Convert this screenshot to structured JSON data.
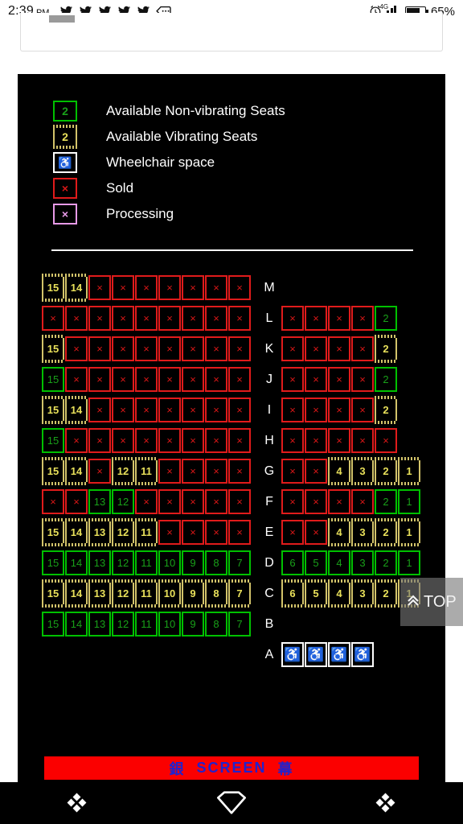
{
  "status_bar": {
    "time": "2:39",
    "ampm": "PM",
    "notification_icons": [
      "twitter-icon",
      "twitter-icon",
      "twitter-icon",
      "twitter-icon",
      "twitter-icon",
      "message-icon"
    ],
    "alarm_icon": "alarm-clock-icon",
    "network": "4G",
    "battery_percent": "65%"
  },
  "legend": {
    "items": [
      {
        "symbol": "2",
        "style": "green",
        "label": "Available Non-vibrating Seats"
      },
      {
        "symbol": "2",
        "style": "yellow",
        "label": "Available Vibrating Seats"
      },
      {
        "symbol": "♿",
        "style": "white",
        "label": "Wheelchair space"
      },
      {
        "symbol": "×",
        "style": "red",
        "label": "Sold"
      },
      {
        "symbol": "×",
        "style": "pink",
        "label": "Processing"
      }
    ]
  },
  "seatmap": {
    "sold_symbol": "×",
    "wheelchair_symbol": "♿",
    "rows": [
      {
        "label": "M",
        "left": [
          {
            "t": "yellow",
            "n": "15"
          },
          {
            "t": "yellow",
            "n": "14"
          },
          {
            "t": "red"
          },
          {
            "t": "red"
          },
          {
            "t": "red"
          },
          {
            "t": "red"
          },
          {
            "t": "red"
          },
          {
            "t": "red"
          },
          {
            "t": "red"
          }
        ],
        "right": []
      },
      {
        "label": "L",
        "left": [
          {
            "t": "red"
          },
          {
            "t": "red"
          },
          {
            "t": "red"
          },
          {
            "t": "red"
          },
          {
            "t": "red"
          },
          {
            "t": "red"
          },
          {
            "t": "red"
          },
          {
            "t": "red"
          },
          {
            "t": "red"
          }
        ],
        "right": [
          {
            "t": "red"
          },
          {
            "t": "red"
          },
          {
            "t": "red"
          },
          {
            "t": "red"
          },
          {
            "t": "green",
            "n": "2"
          }
        ]
      },
      {
        "label": "K",
        "left": [
          {
            "t": "yellow",
            "n": "15"
          },
          {
            "t": "red"
          },
          {
            "t": "red"
          },
          {
            "t": "red"
          },
          {
            "t": "red"
          },
          {
            "t": "red"
          },
          {
            "t": "red"
          },
          {
            "t": "red"
          },
          {
            "t": "red"
          }
        ],
        "right": [
          {
            "t": "red"
          },
          {
            "t": "red"
          },
          {
            "t": "red"
          },
          {
            "t": "red"
          },
          {
            "t": "yellow",
            "n": "2"
          }
        ]
      },
      {
        "label": "J",
        "left": [
          {
            "t": "green",
            "n": "15"
          },
          {
            "t": "red"
          },
          {
            "t": "red"
          },
          {
            "t": "red"
          },
          {
            "t": "red"
          },
          {
            "t": "red"
          },
          {
            "t": "red"
          },
          {
            "t": "red"
          },
          {
            "t": "red"
          }
        ],
        "right": [
          {
            "t": "red"
          },
          {
            "t": "red"
          },
          {
            "t": "red"
          },
          {
            "t": "red"
          },
          {
            "t": "green",
            "n": "2"
          }
        ]
      },
      {
        "label": "I",
        "left": [
          {
            "t": "yellow",
            "n": "15"
          },
          {
            "t": "yellow",
            "n": "14"
          },
          {
            "t": "red"
          },
          {
            "t": "red"
          },
          {
            "t": "red"
          },
          {
            "t": "red"
          },
          {
            "t": "red"
          },
          {
            "t": "red"
          },
          {
            "t": "red"
          }
        ],
        "right": [
          {
            "t": "red"
          },
          {
            "t": "red"
          },
          {
            "t": "red"
          },
          {
            "t": "red"
          },
          {
            "t": "yellow",
            "n": "2"
          }
        ]
      },
      {
        "label": "H",
        "left": [
          {
            "t": "green",
            "n": "15"
          },
          {
            "t": "red"
          },
          {
            "t": "red"
          },
          {
            "t": "red"
          },
          {
            "t": "red"
          },
          {
            "t": "red"
          },
          {
            "t": "red"
          },
          {
            "t": "red"
          },
          {
            "t": "red"
          }
        ],
        "right": [
          {
            "t": "red"
          },
          {
            "t": "red"
          },
          {
            "t": "red"
          },
          {
            "t": "red"
          },
          {
            "t": "red"
          }
        ]
      },
      {
        "label": "G",
        "left": [
          {
            "t": "yellow",
            "n": "15"
          },
          {
            "t": "yellow",
            "n": "14"
          },
          {
            "t": "red"
          },
          {
            "t": "yellow",
            "n": "12"
          },
          {
            "t": "yellow",
            "n": "11"
          },
          {
            "t": "red"
          },
          {
            "t": "red"
          },
          {
            "t": "red"
          },
          {
            "t": "red"
          }
        ],
        "right": [
          {
            "t": "red"
          },
          {
            "t": "red"
          },
          {
            "t": "yellow",
            "n": "4"
          },
          {
            "t": "yellow",
            "n": "3"
          },
          {
            "t": "yellow",
            "n": "2"
          },
          {
            "t": "yellow",
            "n": "1"
          }
        ]
      },
      {
        "label": "F",
        "left": [
          {
            "t": "red"
          },
          {
            "t": "red"
          },
          {
            "t": "green",
            "n": "13"
          },
          {
            "t": "green",
            "n": "12"
          },
          {
            "t": "red"
          },
          {
            "t": "red"
          },
          {
            "t": "red"
          },
          {
            "t": "red"
          },
          {
            "t": "red"
          }
        ],
        "right": [
          {
            "t": "red"
          },
          {
            "t": "red"
          },
          {
            "t": "red"
          },
          {
            "t": "red"
          },
          {
            "t": "green",
            "n": "2"
          },
          {
            "t": "green",
            "n": "1"
          }
        ]
      },
      {
        "label": "E",
        "left": [
          {
            "t": "yellow",
            "n": "15"
          },
          {
            "t": "yellow",
            "n": "14"
          },
          {
            "t": "yellow",
            "n": "13"
          },
          {
            "t": "yellow",
            "n": "12"
          },
          {
            "t": "yellow",
            "n": "11"
          },
          {
            "t": "red"
          },
          {
            "t": "red"
          },
          {
            "t": "red"
          },
          {
            "t": "red"
          }
        ],
        "right": [
          {
            "t": "red"
          },
          {
            "t": "red"
          },
          {
            "t": "yellow",
            "n": "4"
          },
          {
            "t": "yellow",
            "n": "3"
          },
          {
            "t": "yellow",
            "n": "2"
          },
          {
            "t": "yellow",
            "n": "1"
          }
        ]
      },
      {
        "label": "D",
        "left": [
          {
            "t": "green",
            "n": "15"
          },
          {
            "t": "green",
            "n": "14"
          },
          {
            "t": "green",
            "n": "13"
          },
          {
            "t": "green",
            "n": "12"
          },
          {
            "t": "green",
            "n": "11"
          },
          {
            "t": "green",
            "n": "10"
          },
          {
            "t": "green",
            "n": "9"
          },
          {
            "t": "green",
            "n": "8"
          },
          {
            "t": "green",
            "n": "7"
          }
        ],
        "right": [
          {
            "t": "green",
            "n": "6"
          },
          {
            "t": "green",
            "n": "5"
          },
          {
            "t": "green",
            "n": "4"
          },
          {
            "t": "green",
            "n": "3"
          },
          {
            "t": "green",
            "n": "2"
          },
          {
            "t": "green",
            "n": "1"
          }
        ]
      },
      {
        "label": "C",
        "left": [
          {
            "t": "yellow",
            "n": "15"
          },
          {
            "t": "yellow",
            "n": "14"
          },
          {
            "t": "yellow",
            "n": "13"
          },
          {
            "t": "yellow",
            "n": "12"
          },
          {
            "t": "yellow",
            "n": "11"
          },
          {
            "t": "yellow",
            "n": "10"
          },
          {
            "t": "yellow",
            "n": "9"
          },
          {
            "t": "yellow",
            "n": "8"
          },
          {
            "t": "yellow",
            "n": "7"
          }
        ],
        "right": [
          {
            "t": "yellow",
            "n": "6"
          },
          {
            "t": "yellow",
            "n": "5"
          },
          {
            "t": "yellow",
            "n": "4"
          },
          {
            "t": "yellow",
            "n": "3"
          },
          {
            "t": "yellow",
            "n": "2"
          },
          {
            "t": "yellow",
            "n": "1"
          }
        ]
      },
      {
        "label": "B",
        "left": [
          {
            "t": "green",
            "n": "15"
          },
          {
            "t": "green",
            "n": "14"
          },
          {
            "t": "green",
            "n": "13"
          },
          {
            "t": "green",
            "n": "12"
          },
          {
            "t": "green",
            "n": "11"
          },
          {
            "t": "green",
            "n": "10"
          },
          {
            "t": "green",
            "n": "9"
          },
          {
            "t": "green",
            "n": "8"
          },
          {
            "t": "green",
            "n": "7"
          }
        ],
        "right": []
      },
      {
        "label": "A",
        "left": [],
        "right": [
          {
            "t": "wheel"
          },
          {
            "t": "wheel"
          },
          {
            "t": "wheel"
          },
          {
            "t": "wheel"
          }
        ]
      }
    ]
  },
  "screen_bar": {
    "left_char": "銀",
    "text": "SCREEN",
    "right_char": "幕"
  },
  "top_button": {
    "chevron": "«",
    "label": "TOP"
  },
  "nav_bar": {
    "recents_label": "recents-icon",
    "home_label": "home-icon",
    "back_label": "back-icon"
  },
  "colors": {
    "available_green": "#00c000",
    "vibrating_yellow": "#d2c36a",
    "sold_red": "#e01b1b",
    "processing_pink": "#e79ae7",
    "screen_red": "#fb0000",
    "screen_text_blue": "#2222cc"
  }
}
